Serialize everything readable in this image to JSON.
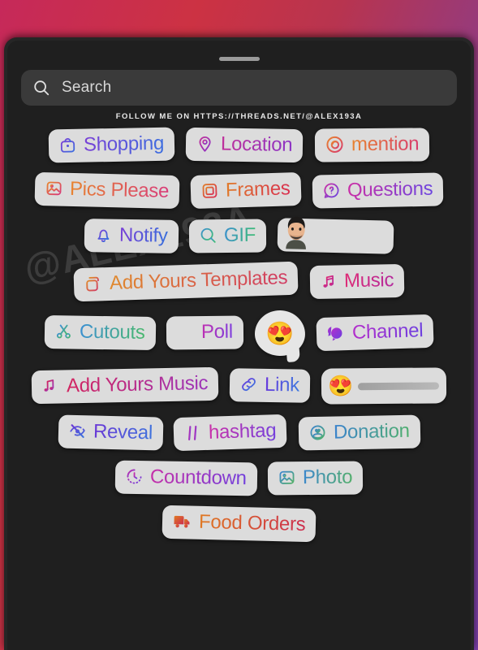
{
  "app": {
    "title": "Instagram Story Sticker Tray",
    "background_gradient_start": "#c6295a",
    "background_gradient_end": "#7a3fa8",
    "sheet_color": "#1f1f1f",
    "sticker_color": "#dcdcdc"
  },
  "sheet": {
    "grabber_label": "drag handle"
  },
  "search": {
    "icon": "search-icon",
    "placeholder": "Search",
    "value": ""
  },
  "banner": {
    "text": "FOLLOW ME ON HTTPS://THREADS.NET/@ALEX193A"
  },
  "watermark": {
    "text": "@ALEX193A"
  },
  "rows": [
    {
      "stickers": [
        {
          "name": "shopping",
          "label": "Shopping",
          "icon": "shopping-bag-icon",
          "color_start": "#7a3fd6",
          "color_end": "#3b6ee0"
        },
        {
          "name": "location",
          "label": "Location",
          "icon": "location-pin-icon",
          "color_start": "#c0309a",
          "color_end": "#8b34c6"
        },
        {
          "name": "mention",
          "label": "mention",
          "icon": "threads-at-icon",
          "color_start": "#e8852e",
          "color_end": "#d83a6e"
        }
      ]
    },
    {
      "stickers": [
        {
          "name": "pics-please",
          "label": "Pics Please",
          "icon": "photo-frame-icon",
          "color_start": "#e8852e",
          "color_end": "#d8397a"
        },
        {
          "name": "frames",
          "label": "Frames",
          "icon": "square-frame-icon",
          "color_start": "#e07d2a",
          "color_end": "#d92c50"
        },
        {
          "name": "questions",
          "label": "Questions",
          "icon": "question-bubble-icon",
          "color_start": "#cc2fa6",
          "color_end": "#6a45e0"
        }
      ]
    },
    {
      "stickers": [
        {
          "name": "notify",
          "label": "Notify",
          "icon": "bell-icon",
          "color_start": "#7b3fd6",
          "color_end": "#3570dd"
        },
        {
          "name": "gif",
          "label": "GIF",
          "icon": "search-icon",
          "color_start": "#3b8fd0",
          "color_end": "#3fbf72"
        }
      ],
      "avatar": {
        "name": "avatar-sticker",
        "alt": "memoji avatar",
        "label": ""
      }
    },
    {
      "stickers": [
        {
          "name": "add-yours-templates",
          "label": "Add Yours Templates",
          "icon": "add-yours-plus-icon",
          "color_start": "#e08a2c",
          "color_end": "#d13a63"
        },
        {
          "name": "music",
          "label": "Music",
          "icon": "music-note-icon",
          "color_start": "#e02a74",
          "color_end": "#b32a9e"
        }
      ]
    },
    {
      "stickers": [
        {
          "name": "cutouts",
          "label": "Cutouts",
          "icon": "scissors-icon",
          "color_start": "#3b8fd4",
          "color_end": "#49b96a"
        },
        {
          "name": "poll",
          "label": "Poll",
          "icon": "poll-bars-icon",
          "color_start": "#c22fb0",
          "color_end": "#7a3fe0"
        },
        {
          "name": "channel",
          "label": "Channel",
          "icon": "chat-bubbles-icon",
          "color_start": "#b52ecb",
          "color_end": "#6b3fe0"
        }
      ],
      "emoji_bubble": {
        "name": "emoji-reaction-sticker",
        "emoji": "😍"
      }
    },
    {
      "stickers": [
        {
          "name": "add-yours-music",
          "label": "Add Yours Music",
          "icon": "music-plus-icon",
          "color_start": "#d3245e",
          "color_end": "#9b34bb"
        },
        {
          "name": "link",
          "label": "Link",
          "icon": "link-chain-icon",
          "color_start": "#6a36dd",
          "color_end": "#3b7bdf"
        }
      ],
      "emoji_slider": {
        "name": "emoji-slider-sticker",
        "emoji": "😍",
        "value": 0
      }
    },
    {
      "stickers": [
        {
          "name": "reveal",
          "label": "Reveal",
          "icon": "eye-slash-icon",
          "color_start": "#6b36d6",
          "color_end": "#3d74dd"
        },
        {
          "name": "hashtag",
          "label": "hashtag",
          "icon": "hash-icon",
          "color_start": "#cc2fa8",
          "color_end": "#7340dd"
        },
        {
          "name": "donation",
          "label": "Donation",
          "icon": "heart-circle-icon",
          "color_start": "#3b82cf",
          "color_end": "#4fb06a"
        }
      ]
    },
    {
      "stickers": [
        {
          "name": "countdown",
          "label": "Countdown",
          "icon": "countdown-clock-icon",
          "color_start": "#c72fa8",
          "color_end": "#6f3fdd"
        },
        {
          "name": "photo",
          "label": "Photo",
          "icon": "photo-icon",
          "color_start": "#3b86cf",
          "color_end": "#55b06a"
        }
      ]
    },
    {
      "stickers": [
        {
          "name": "food-orders",
          "label": "Food Orders",
          "icon": "delivery-truck-icon",
          "color_start": "#e07a22",
          "color_end": "#cc2b4e"
        }
      ]
    }
  ]
}
